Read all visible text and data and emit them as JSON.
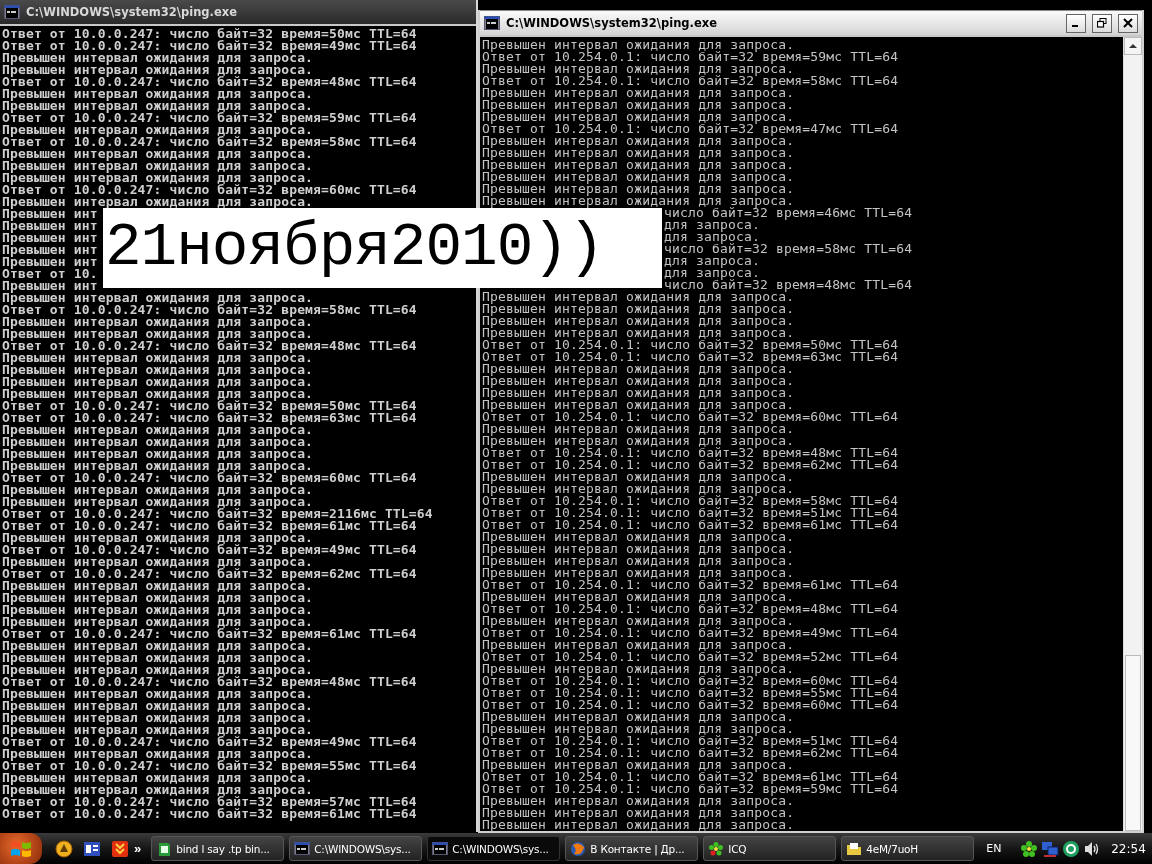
{
  "windows": [
    {
      "title": "C:\\WINDOWS\\system32\\ping.exe",
      "active": false,
      "lines": [
        {
          "text": "Ответ от 10.0.0.247: число байт=32 время=50мс TTL=64",
          "kind": "full"
        },
        {
          "text": "Ответ от 10.0.0.247: число байт=32 время=49мс TTL=64",
          "kind": "full"
        },
        {
          "text": "Превышен интервал ожидания для запроса.",
          "kind": "full"
        },
        {
          "text": "Превышен интервал ожидания для запроса.",
          "kind": "full"
        },
        {
          "text": "Ответ от 10.0.0.247: число байт=32 время=48мс TTL=64",
          "kind": "full"
        },
        {
          "text": "Превышен интервал ожидания для запроса.",
          "kind": "full"
        },
        {
          "text": "Превышен интервал ожидания для запроса.",
          "kind": "full"
        },
        {
          "text": "Ответ от 10.0.0.247: число байт=32 время=59мс TTL=64",
          "kind": "full"
        },
        {
          "text": "Превышен интервал ожидания для запроса.",
          "kind": "full"
        },
        {
          "text": "Ответ от 10.0.0.247: число байт=32 время=58мс TTL=64",
          "kind": "full"
        },
        {
          "text": "Превышен интервал ожидания для запроса.",
          "kind": "full"
        },
        {
          "text": "Превышен интервал ожидания для запроса.",
          "kind": "full"
        },
        {
          "text": "Превышен интервал ожидания для запроса.",
          "kind": "full"
        },
        {
          "text": "Ответ от 10.0.0.247: число байт=32 время=60мс TTL=64",
          "kind": "full"
        },
        {
          "text": "Превышен интервал ожидания для запроса.",
          "kind": "full"
        },
        {
          "text": "Превышен инт",
          "kind": "full"
        },
        {
          "text": "Превышен инт",
          "kind": "full"
        },
        {
          "text": "Превышен инт",
          "kind": "full"
        },
        {
          "text": "Превышен инт",
          "kind": "full"
        },
        {
          "text": "Превышен инт",
          "kind": "full"
        },
        {
          "text": "Ответ от 10.",
          "kind": "full"
        },
        {
          "text": "Превышен инт",
          "kind": "full"
        },
        {
          "text": "Превышен интервал ожидания для запроса.",
          "kind": "full"
        },
        {
          "text": "Ответ от 10.0.0.247: число байт=32 время=58мс TTL=64",
          "kind": "full"
        },
        {
          "text": "Превышен интервал ожидания для запроса.",
          "kind": "full"
        },
        {
          "text": "Превышен интервал ожидания для запроса.",
          "kind": "full"
        },
        {
          "text": "Ответ от 10.0.0.247: число байт=32 время=48мс TTL=64",
          "kind": "full"
        },
        {
          "text": "Превышен интервал ожидания для запроса.",
          "kind": "full"
        },
        {
          "text": "Превышен интервал ожидания для запроса.",
          "kind": "full"
        },
        {
          "text": "Превышен интервал ожидания для запроса.",
          "kind": "full"
        },
        {
          "text": "Превышен интервал ожидания для запроса.",
          "kind": "full"
        },
        {
          "text": "Ответ от 10.0.0.247: число байт=32 время=50мс TTL=64",
          "kind": "full"
        },
        {
          "text": "Ответ от 10.0.0.247: число байт=32 время=63мс TTL=64",
          "kind": "full"
        },
        {
          "text": "Превышен интервал ожидания для запроса.",
          "kind": "full"
        },
        {
          "text": "Превышен интервал ожидания для запроса.",
          "kind": "full"
        },
        {
          "text": "Превышен интервал ожидания для запроса.",
          "kind": "full"
        },
        {
          "text": "Превышен интервал ожидания для запроса.",
          "kind": "full"
        },
        {
          "text": "Ответ от 10.0.0.247: число байт=32 время=60мс TTL=64",
          "kind": "full"
        },
        {
          "text": "Превышен интервал ожидания для запроса.",
          "kind": "full"
        },
        {
          "text": "Превышен интервал ожидания для запроса.",
          "kind": "full"
        },
        {
          "text": "Ответ от 10.0.0.247: число байт=32 время=2116мс TTL=64",
          "kind": "full"
        },
        {
          "text": "Ответ от 10.0.0.247: число байт=32 время=61мс TTL=64",
          "kind": "full"
        },
        {
          "text": "Превышен интервал ожидания для запроса.",
          "kind": "full"
        },
        {
          "text": "Ответ от 10.0.0.247: число байт=32 время=49мс TTL=64",
          "kind": "full"
        },
        {
          "text": "Превышен интервал ожидания для запроса.",
          "kind": "full"
        },
        {
          "text": "Ответ от 10.0.0.247: число байт=32 время=62мс TTL=64",
          "kind": "full"
        },
        {
          "text": "Превышен интервал ожидания для запроса.",
          "kind": "full"
        },
        {
          "text": "Превышен интервал ожидания для запроса.",
          "kind": "full"
        },
        {
          "text": "Превышен интервал ожидания для запроса.",
          "kind": "full"
        },
        {
          "text": "Превышен интервал ожидания для запроса.",
          "kind": "full"
        },
        {
          "text": "Ответ от 10.0.0.247: число байт=32 время=61мс TTL=64",
          "kind": "full"
        },
        {
          "text": "Превышен интервал ожидания для запроса.",
          "kind": "full"
        },
        {
          "text": "Превышен интервал ожидания для запроса.",
          "kind": "full"
        },
        {
          "text": "Превышен интервал ожидания для запроса.",
          "kind": "full"
        },
        {
          "text": "Ответ от 10.0.0.247: число байт=32 время=48мс TTL=64",
          "kind": "full"
        },
        {
          "text": "Превышен интервал ожидания для запроса.",
          "kind": "full"
        },
        {
          "text": "Превышен интервал ожидания для запроса.",
          "kind": "full"
        },
        {
          "text": "Превышен интервал ожидания для запроса.",
          "kind": "full"
        },
        {
          "text": "Превышен интервал ожидания для запроса.",
          "kind": "full"
        },
        {
          "text": "Ответ от 10.0.0.247: число байт=32 время=49мс TTL=64",
          "kind": "full"
        },
        {
          "text": "Превышен интервал ожидания для запроса.",
          "kind": "full"
        },
        {
          "text": "Ответ от 10.0.0.247: число байт=32 время=55мс TTL=64",
          "kind": "full"
        },
        {
          "text": "Превышен интервал ожидания для запроса.",
          "kind": "full"
        },
        {
          "text": "Превышен интервал ожидания для запроса.",
          "kind": "full"
        },
        {
          "text": "Ответ от 10.0.0.247: число байт=32 время=57мс TTL=64",
          "kind": "full"
        },
        {
          "text": "Ответ от 10.0.0.247: число байт=32 время=61мс TTL=64",
          "kind": "full"
        }
      ]
    },
    {
      "title": "C:\\WINDOWS\\system32\\ping.exe",
      "active": true,
      "lines": [
        {
          "text": "Превышен интервал ожидания для запроса.",
          "kind": "full"
        },
        {
          "text": "Ответ от 10.254.0.1: число байт=32 время=59мс TTL=64",
          "kind": "full"
        },
        {
          "text": "Превышен интервал ожидания для запроса.",
          "kind": "full"
        },
        {
          "text": "Ответ от 10.254.0.1: число байт=32 время=58мс TTL=64",
          "kind": "full"
        },
        {
          "text": "Превышен интервал ожидания для запроса.",
          "kind": "full"
        },
        {
          "text": "Превышен интервал ожидания для запроса.",
          "kind": "full"
        },
        {
          "text": "Превышен интервал ожидания для запроса.",
          "kind": "full"
        },
        {
          "text": "Ответ от 10.254.0.1: число байт=32 время=47мс TTL=64",
          "kind": "full"
        },
        {
          "text": "Превышен интервал ожидания для запроса.",
          "kind": "full"
        },
        {
          "text": "Превышен интервал ожидания для запроса.",
          "kind": "full"
        },
        {
          "text": "Превышен интервал ожидания для запроса.",
          "kind": "full"
        },
        {
          "text": "Превышен интервал ожидания для запроса.",
          "kind": "full"
        },
        {
          "text": "Превышен интервал ожидания для запроса.",
          "kind": "full"
        },
        {
          "text": "Превышен интервал ожидания для запроса.",
          "kind": "full"
        },
        {
          "text": "число байт=32 время=46мс TTL=64",
          "kind": "tail"
        },
        {
          "text": "для запроса.",
          "kind": "tail"
        },
        {
          "text": "для запроса.",
          "kind": "tail"
        },
        {
          "text": "число байт=32 время=58мс TTL=64",
          "kind": "tail"
        },
        {
          "text": "для запроса.",
          "kind": "tail"
        },
        {
          "text": "для запроса.",
          "kind": "tail"
        },
        {
          "text": "число байт=32 время=48мс TTL=64",
          "kind": "tail"
        },
        {
          "text": "Превышен интервал ожидания для запроса.",
          "kind": "full"
        },
        {
          "text": "Превышен интервал ожидания для запроса.",
          "kind": "full"
        },
        {
          "text": "Превышен интервал ожидания для запроса.",
          "kind": "full"
        },
        {
          "text": "Превышен интервал ожидания для запроса.",
          "kind": "full"
        },
        {
          "text": "Ответ от 10.254.0.1: число байт=32 время=50мс TTL=64",
          "kind": "full"
        },
        {
          "text": "Ответ от 10.254.0.1: число байт=32 время=63мс TTL=64",
          "kind": "full"
        },
        {
          "text": "Превышен интервал ожидания для запроса.",
          "kind": "full"
        },
        {
          "text": "Превышен интервал ожидания для запроса.",
          "kind": "full"
        },
        {
          "text": "Превышен интервал ожидания для запроса.",
          "kind": "full"
        },
        {
          "text": "Превышен интервал ожидания для запроса.",
          "kind": "full"
        },
        {
          "text": "Ответ от 10.254.0.1: число байт=32 время=60мс TTL=64",
          "kind": "full"
        },
        {
          "text": "Превышен интервал ожидания для запроса.",
          "kind": "full"
        },
        {
          "text": "Превышен интервал ожидания для запроса.",
          "kind": "full"
        },
        {
          "text": "Ответ от 10.254.0.1: число байт=32 время=48мс TTL=64",
          "kind": "full"
        },
        {
          "text": "Ответ от 10.254.0.1: число байт=32 время=62мс TTL=64",
          "kind": "full"
        },
        {
          "text": "Превышен интервал ожидания для запроса.",
          "kind": "full"
        },
        {
          "text": "Превышен интервал ожидания для запроса.",
          "kind": "full"
        },
        {
          "text": "Ответ от 10.254.0.1: число байт=32 время=58мс TTL=64",
          "kind": "full"
        },
        {
          "text": "Ответ от 10.254.0.1: число байт=32 время=51мс TTL=64",
          "kind": "full"
        },
        {
          "text": "Ответ от 10.254.0.1: число байт=32 время=61мс TTL=64",
          "kind": "full"
        },
        {
          "text": "Превышен интервал ожидания для запроса.",
          "kind": "full"
        },
        {
          "text": "Превышен интервал ожидания для запроса.",
          "kind": "full"
        },
        {
          "text": "Превышен интервал ожидания для запроса.",
          "kind": "full"
        },
        {
          "text": "Превышен интервал ожидания для запроса.",
          "kind": "full"
        },
        {
          "text": "Ответ от 10.254.0.1: число байт=32 время=61мс TTL=64",
          "kind": "full"
        },
        {
          "text": "Превышен интервал ожидания для запроса.",
          "kind": "full"
        },
        {
          "text": "Ответ от 10.254.0.1: число байт=32 время=48мс TTL=64",
          "kind": "full"
        },
        {
          "text": "Превышен интервал ожидания для запроса.",
          "kind": "full"
        },
        {
          "text": "Ответ от 10.254.0.1: число байт=32 время=49мс TTL=64",
          "kind": "full"
        },
        {
          "text": "Превышен интервал ожидания для запроса.",
          "kind": "full"
        },
        {
          "text": "Ответ от 10.254.0.1: число байт=32 время=52мс TTL=64",
          "kind": "full"
        },
        {
          "text": "Превышен интервал ожидания для запроса.",
          "kind": "full"
        },
        {
          "text": "Ответ от 10.254.0.1: число байт=32 время=60мс TTL=64",
          "kind": "full"
        },
        {
          "text": "Ответ от 10.254.0.1: число байт=32 время=55мс TTL=64",
          "kind": "full"
        },
        {
          "text": "Ответ от 10.254.0.1: число байт=32 время=60мс TTL=64",
          "kind": "full"
        },
        {
          "text": "Превышен интервал ожидания для запроса.",
          "kind": "full"
        },
        {
          "text": "Превышен интервал ожидания для запроса.",
          "kind": "full"
        },
        {
          "text": "Ответ от 10.254.0.1: число байт=32 время=51мс TTL=64",
          "kind": "full"
        },
        {
          "text": "Ответ от 10.254.0.1: число байт=32 время=62мс TTL=64",
          "kind": "full"
        },
        {
          "text": "Превышен интервал ожидания для запроса.",
          "kind": "full"
        },
        {
          "text": "Ответ от 10.254.0.1: число байт=32 время=61мс TTL=64",
          "kind": "full"
        },
        {
          "text": "Ответ от 10.254.0.1: число байт=32 время=59мс TTL=64",
          "kind": "full"
        },
        {
          "text": "Превышен интервал ожидания для запроса.",
          "kind": "full"
        },
        {
          "text": "Превышен интервал ожидания для запроса.",
          "kind": "full"
        },
        {
          "text": "Превышен интервал ожидания для запроса.",
          "kind": "full"
        }
      ]
    }
  ],
  "overlay_caption": {
    "text": "21ноября2010))"
  },
  "taskbar": {
    "quick_launch_more": "»",
    "tasks": [
      {
        "label": "bind l say .tp   bin...",
        "kind": "sheet",
        "selected": false
      },
      {
        "label": "C:\\WINDOWS\\sys...",
        "kind": "console",
        "selected": false
      },
      {
        "label": "C:\\WINDOWS\\sys...",
        "kind": "console",
        "selected": true
      },
      {
        "label": "В Контакте | Др...",
        "kind": "browser",
        "selected": false
      },
      {
        "label": "ICQ",
        "kind": "flower",
        "selected": false
      },
      {
        "label": "4eM/7uoH",
        "kind": "folder",
        "selected": false
      }
    ],
    "language": "EN",
    "clock": "22:54"
  }
}
